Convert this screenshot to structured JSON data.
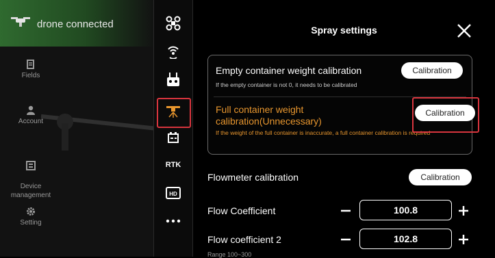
{
  "sidebar": {
    "connection_status": "drone connected",
    "items": [
      {
        "label": "Fields",
        "icon": "fields-icon"
      },
      {
        "label": "Account",
        "icon": "account-icon"
      },
      {
        "label": "Device\nmanagement",
        "icon": "device-management-icon"
      },
      {
        "label": "Setting",
        "icon": "setting-icon"
      }
    ]
  },
  "toolbar": {
    "items": [
      "drone-icon",
      "signal-icon",
      "remote-controller-icon",
      "spray-icon",
      "battery-icon",
      "rtk-text",
      "hd-icon",
      "more-icon"
    ],
    "rtk_label": "RTK",
    "hd_label": "HD",
    "active_item": "spray-icon"
  },
  "panel": {
    "title": "Spray settings",
    "empty_calibration": {
      "title": "Empty container weight calibration",
      "description": "If the empty container is not 0, it needs to be calibrated",
      "button": "Calibration"
    },
    "full_calibration": {
      "title": "Full container weight calibration(Unnecessary)",
      "description": "If the weight of the full container is inaccurate, a full container calibration is required",
      "button": "Calibration"
    },
    "flowmeter": {
      "label": "Flowmeter calibration",
      "button": "Calibration"
    },
    "flow_coefficient": {
      "label": "Flow Coefficient",
      "value": "100.8"
    },
    "flow_coefficient_2": {
      "label": "Flow coefficient 2",
      "value": "102.8"
    },
    "range_label": "Range 100~300"
  },
  "colors": {
    "accent_orange": "#e8962e",
    "highlight_red": "#d9353e",
    "banner_green": "#2f6a2f"
  }
}
